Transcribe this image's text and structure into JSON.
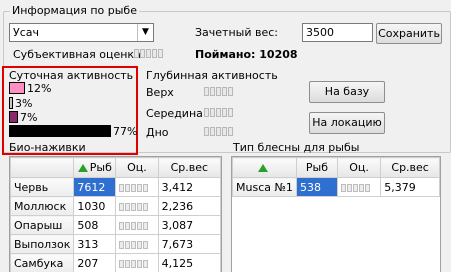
{
  "group_title": "Информация по рыбе",
  "fish_select": {
    "value": "Усач",
    "arrow": "▼"
  },
  "score_label": "Зачетный вес:",
  "score_value": "3500",
  "save_button": "Сохранить",
  "subjective_label": "Субъективная оценка",
  "caught_label": "Поймано: 10208",
  "daily_title": "Суточная активность",
  "daily_bars": [
    {
      "pct": "12%",
      "fraction": 0.12,
      "color": "#ff8fc0"
    },
    {
      "pct": "3%",
      "fraction": 0.03,
      "color": "#c8c8c8"
    },
    {
      "pct": "7%",
      "fraction": 0.07,
      "color": "#8a2a6a"
    },
    {
      "pct": "77%",
      "fraction": 0.77,
      "color": "#000000"
    }
  ],
  "bait_label": "Био-наживки",
  "depth_title": "Глубинная активность",
  "depth_labels": [
    "Верх",
    "Середина",
    "Дно"
  ],
  "to_base_button": "На базу",
  "to_location_button": "На локацию",
  "lure_title": "Тип блесны для рыбы",
  "left_table": {
    "headers": [
      "Рыб",
      "Оц.",
      "Ср.вес"
    ],
    "rows": [
      {
        "name": "Червь",
        "count": "7612",
        "avg": "3,412",
        "selected": true
      },
      {
        "name": "Моллюск",
        "count": "1030",
        "avg": "2,236"
      },
      {
        "name": "Опарыш",
        "count": "508",
        "avg": "3,087"
      },
      {
        "name": "Выползок",
        "count": "313",
        "avg": "7,673"
      },
      {
        "name": "Самбука",
        "count": "207",
        "avg": "4,125"
      }
    ]
  },
  "right_table": {
    "headers": [
      "Рыб",
      "Оц.",
      "Ср.вес"
    ],
    "rows": [
      {
        "name": "Musca №1",
        "count": "538",
        "avg": "5,379",
        "selected": true
      }
    ]
  }
}
